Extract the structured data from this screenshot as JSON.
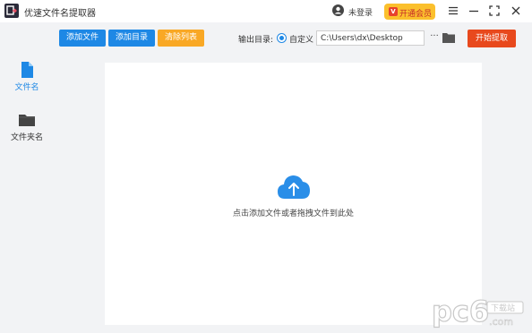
{
  "window": {
    "title": "优速文件名提取器",
    "login_text": "未登录",
    "vip_label": "开通会员",
    "vip_badge": "V"
  },
  "sidebar": {
    "items": [
      {
        "label": "文件名",
        "icon": "file-icon",
        "active": true
      },
      {
        "label": "文件夹名",
        "icon": "folder-icon",
        "active": false
      }
    ]
  },
  "toolbar": {
    "add_file": "添加文件",
    "add_folder": "添加目录",
    "clear_list": "清除列表",
    "output_label": "输出目录:",
    "radio_label": "自定义",
    "output_path": "C:\\Users\\dx\\Desktop",
    "more": "···",
    "start": "开始提取"
  },
  "main": {
    "drop_hint": "点击添加文件或者拖拽文件到此处"
  },
  "watermark": {
    "text": "pc6",
    "subtext": "下载站",
    "domain": ".com"
  },
  "colors": {
    "blue": "#1e88e5",
    "orange": "#f9a825",
    "red": "#e8491d",
    "sidebar_bg": "#f2f3f5",
    "active_text": "#1e88e5"
  }
}
